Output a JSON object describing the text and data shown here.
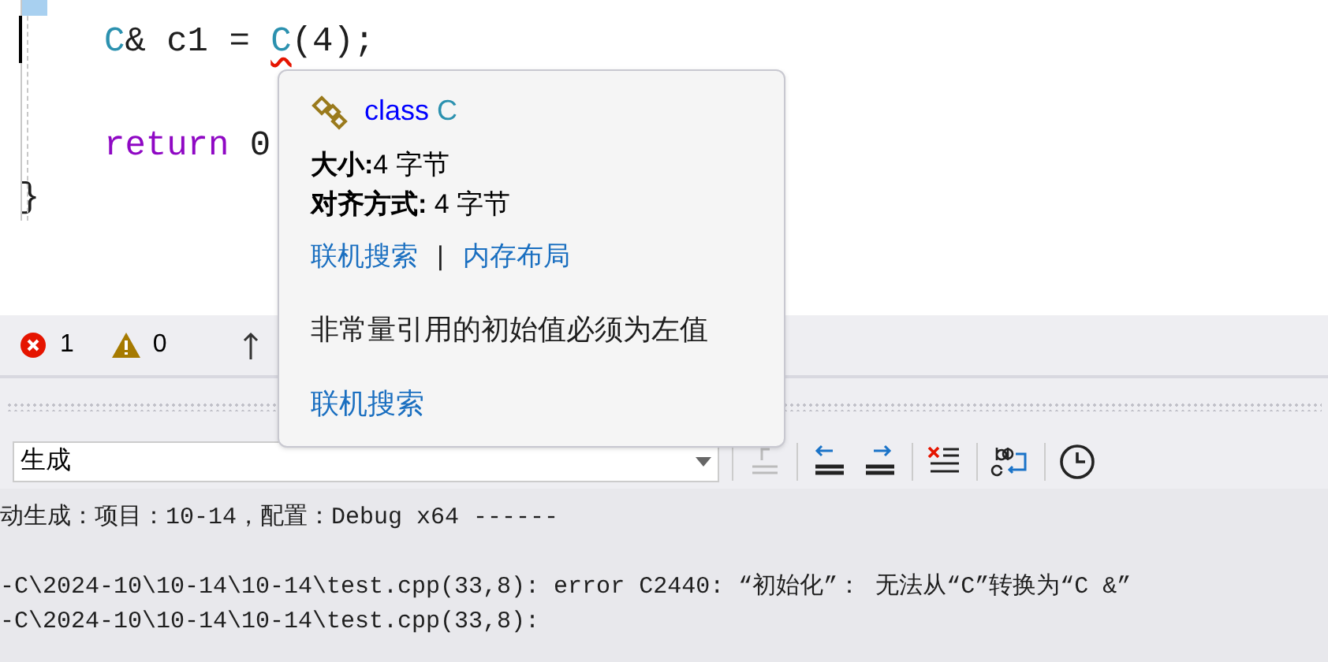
{
  "editor": {
    "lines": [
      {
        "blank_before": false,
        "segments": [
          {
            "text": "C",
            "kind": "type",
            "error": false
          },
          {
            "text": "& c1 = ",
            "kind": "plain",
            "error": false
          },
          {
            "text": "C",
            "kind": "type",
            "error": true
          },
          {
            "text": "(4);",
            "kind": "plain",
            "error": false
          }
        ]
      },
      {
        "blank_before": true,
        "segments": [
          {
            "text": "return",
            "kind": "keyword",
            "error": false
          },
          {
            "text": " 0",
            "kind": "plain",
            "error": false
          }
        ]
      }
    ],
    "closing": "}"
  },
  "status": {
    "errors": "1",
    "warnings": "0"
  },
  "tooltip": {
    "keyword": "class",
    "name": "C",
    "rows": [
      {
        "label": "大小:",
        "value": "4 字节"
      },
      {
        "label": "对齐方式:",
        "value": " 4 字节"
      }
    ],
    "links": [
      "联机搜索",
      "内存布局"
    ],
    "separator": "|",
    "message": "非常量引用的初始值必须为左值",
    "bottom_link": "联机搜索"
  },
  "output": {
    "source": "生成",
    "header": "动生成：项目：10-14，配置：Debug x64 ------",
    "lines": [
      "-C\\2024-10\\10-14\\10-14\\test.cpp(33,8): error C2440: “初始化”： 无法从“C”转换为“C &”",
      "-C\\2024-10\\10-14\\10-14\\test.cpp(33,8):"
    ]
  }
}
